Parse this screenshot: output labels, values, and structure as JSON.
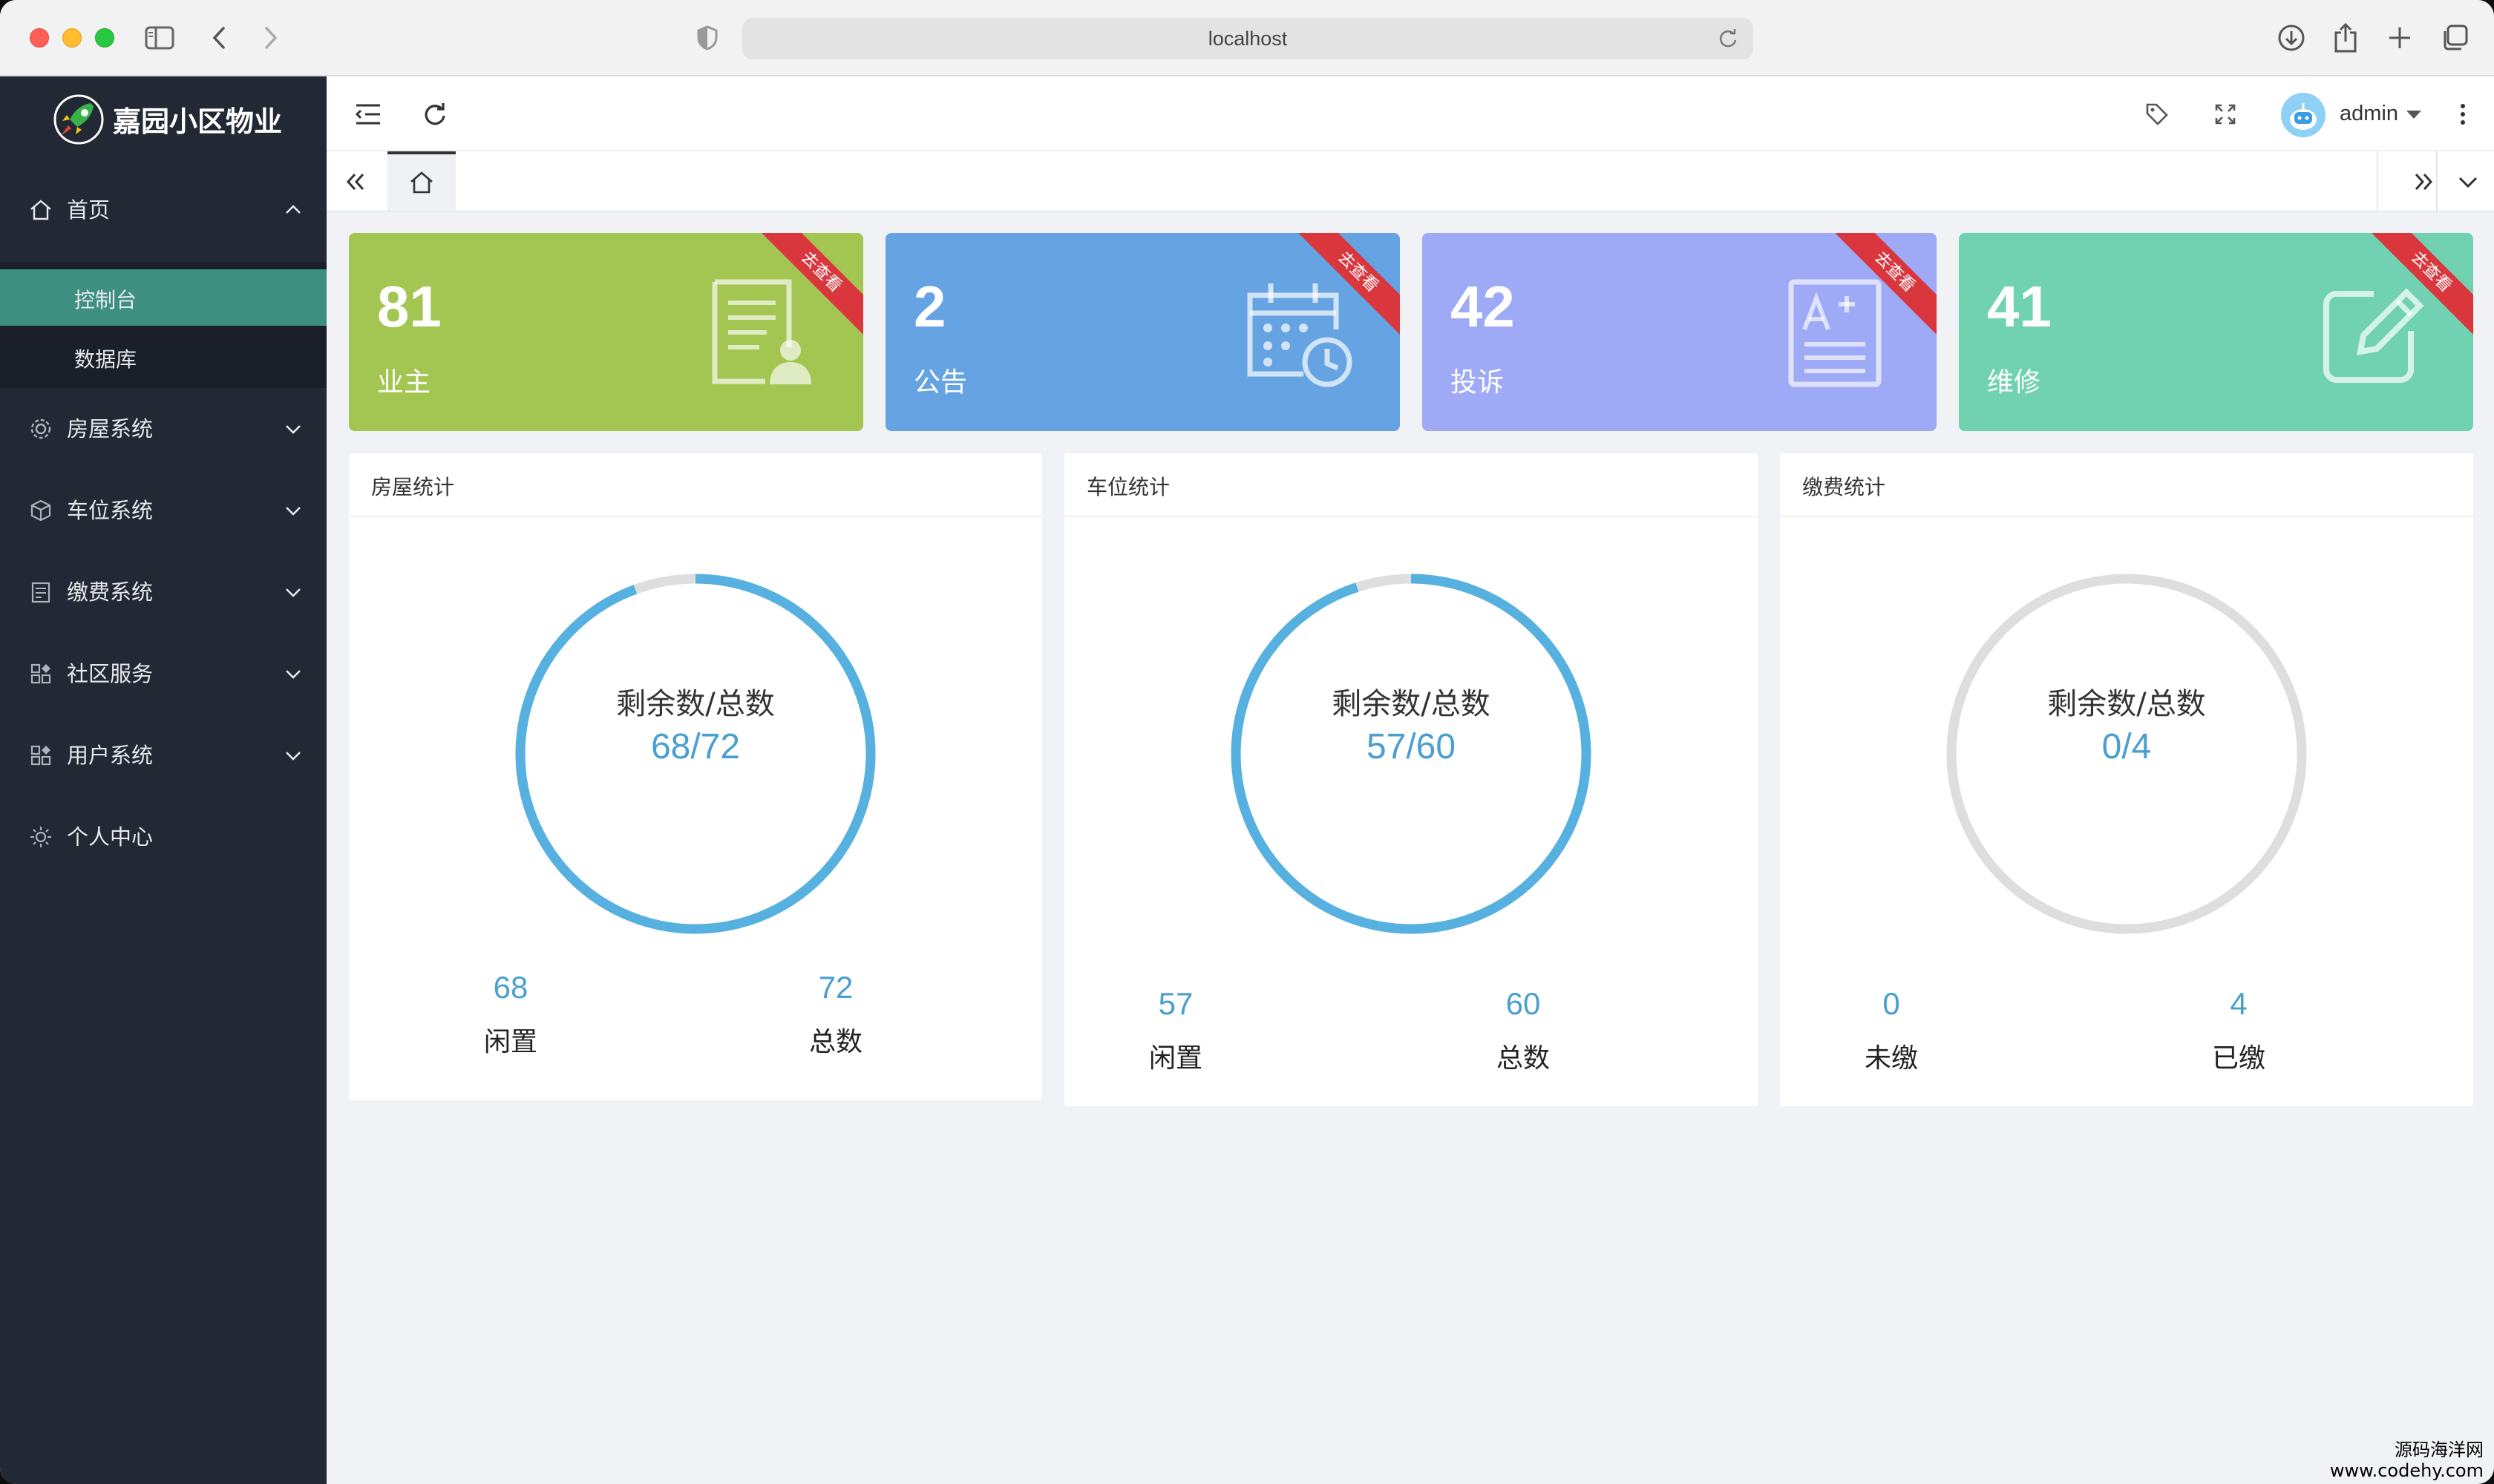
{
  "browser": {
    "url": "localhost"
  },
  "sidebar": {
    "brand": "嘉园小区物业",
    "items": [
      {
        "label": "首页",
        "icon": "home-icon",
        "expanded": true,
        "children": [
          {
            "label": "控制台",
            "active": true
          },
          {
            "label": "数据库",
            "active": false
          }
        ]
      },
      {
        "label": "房屋系统",
        "icon": "gear-icon"
      },
      {
        "label": "车位系统",
        "icon": "cube-icon"
      },
      {
        "label": "缴费系统",
        "icon": "receipt-icon"
      },
      {
        "label": "社区服务",
        "icon": "grid-icon"
      },
      {
        "label": "用户系统",
        "icon": "grid-icon"
      },
      {
        "label": "个人中心",
        "icon": "sun-gear-icon"
      }
    ]
  },
  "header": {
    "user": "admin"
  },
  "cards": [
    {
      "value": "81",
      "label": "业主",
      "ribbon": "去查看",
      "color": "#a3c551",
      "icon": "resume-icon"
    },
    {
      "value": "2",
      "label": "公告",
      "ribbon": "去查看",
      "color": "#65a3e2",
      "icon": "calendar-clock-icon"
    },
    {
      "value": "42",
      "label": "投诉",
      "ribbon": "去查看",
      "color": "#9eaaf5",
      "icon": "document-a-icon"
    },
    {
      "value": "41",
      "label": "维修",
      "ribbon": "去查看",
      "color": "#71d2b1",
      "icon": "edit-icon"
    }
  ],
  "stats": [
    {
      "title": "房屋统计",
      "caption": "剩余数/总数",
      "ratio": "68/72",
      "fill_fraction": 0.944,
      "left": {
        "value": "68",
        "label": "闲置"
      },
      "right": {
        "value": "72",
        "label": "总数"
      }
    },
    {
      "title": "车位统计",
      "caption": "剩余数/总数",
      "ratio": "57/60",
      "fill_fraction": 0.95,
      "left": {
        "value": "57",
        "label": "闲置"
      },
      "right": {
        "value": "60",
        "label": "总数"
      }
    },
    {
      "title": "缴费统计",
      "caption": "剩余数/总数",
      "ratio": "0/4",
      "fill_fraction": 0,
      "left": {
        "value": "0",
        "label": "未缴"
      },
      "right": {
        "value": "4",
        "label": "已缴"
      }
    }
  ],
  "colors": {
    "ring_fill": "#56b0e0",
    "ring_track": "#dedede"
  },
  "watermark": {
    "line1": "源码海洋网",
    "line2": "www.codehy.com"
  }
}
